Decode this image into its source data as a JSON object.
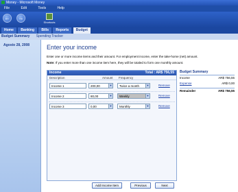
{
  "window": {
    "title": "Money - Microsoft Money"
  },
  "menu": {
    "items": [
      "File",
      "Edit",
      "Tools",
      "Help"
    ]
  },
  "toolbar": {
    "back_glyph": "←",
    "forward_glyph": "→",
    "shortcuts_label": "Shortcuts"
  },
  "tabs": [
    "Home",
    "Banking",
    "Bills",
    "Reports",
    "Budget"
  ],
  "subnav": [
    "Budget Summary",
    "Spending Tracker"
  ],
  "sidebar": {
    "date": "Agosto 28, 2008"
  },
  "page": {
    "heading": "Enter your income",
    "intro": "Enter one or more income items and their amount. For employment income, enter the take-home (net) amount.",
    "note_label": "Note:",
    "note_text": "If you enter more than one income item here, they will be totaled to form one monthly amount."
  },
  "income": {
    "title": "Income",
    "total_label": "Total :",
    "total_value": "AR$ 756,55",
    "columns": {
      "description": "Description",
      "amount": "Amount",
      "frequency": "Frequency"
    },
    "rows": [
      {
        "description": "Income 1",
        "amount": "200,00",
        "frequency": "Twice a month",
        "remove": "Remove"
      },
      {
        "description": "Income 2",
        "amount": "80,00",
        "frequency": "Weekly",
        "remove": "Remove"
      },
      {
        "description": "Income 3",
        "amount": "0,00",
        "frequency": "Monthly",
        "remove": "Remove"
      }
    ]
  },
  "buttons": {
    "add": "Add Income Item",
    "previous": "Previous",
    "next": "Next"
  },
  "summary": {
    "title": "Budget Summary",
    "income_label": "Income",
    "income_value": "AR$ 756,55",
    "expense_label": "Expense",
    "expense_value": "AR$ 0,00",
    "remainder_label": "Remainder",
    "remainder_value": "AR$ 756,55"
  },
  "colors": {
    "accent": "#1c3d8f",
    "header_blue": "#2a55ad",
    "link": "#1a3fa8"
  }
}
